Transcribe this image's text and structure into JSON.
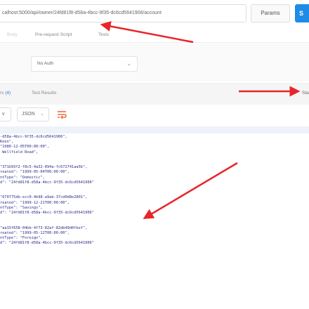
{
  "request": {
    "url": "calhost:5000/api/owner/24fd81f8-d58a-4bcc-9f35-dc6cd5641906/account",
    "params_label": "Params",
    "send_label": "S"
  },
  "request_tabs": {
    "body": "Body",
    "prerequest": "Pre-request Script",
    "tests": "Tests"
  },
  "auth": {
    "type": "No Auth"
  },
  "response_tabs": {
    "headers": "rs",
    "headers_count": "(4)",
    "test_results": "Test Results",
    "status": "Sta"
  },
  "response_toolbar": {
    "view": "v",
    "format": "JSON"
  },
  "response_body": "-d58a-4bcc-9f35-dc6cd5641906\",\nKeen\",\n\"1980-12-05T00:00:00\",\n Wellfield Road\",\n\n\n\"371b93f2-f8c5-4a32-894a-fc672741aa5b\",\nreated\": \"1999-05-04T00:00:00\",\nntType\": \"Domestic\",\nd\": \"24fd81f8-d58a-4bcc-9f35-dc6cd5641906\"\n\n\n\"670775db-ecc0-4b98-a9ab-37cd0d8e2801\",\nreated\": \"1999-12-21T00:00:00\",\nntType\": \"Savings\",\nd\": \"24fd81f8-d58a-4bcc-9f35-dc6cd5641906\"\n\n\n\"aa15f658-04bb-4f73-82af-82db49d0fbef\",\nreated\": \"1999-05-12T00:00:00\",\nntType\": \"Foreign\",\nd\": \"24fd81f8-d58a-4bcc-9f35-dc6cd5641906\"",
  "annotation_color": "#e8252a",
  "accent_color": "#1e8ce6"
}
